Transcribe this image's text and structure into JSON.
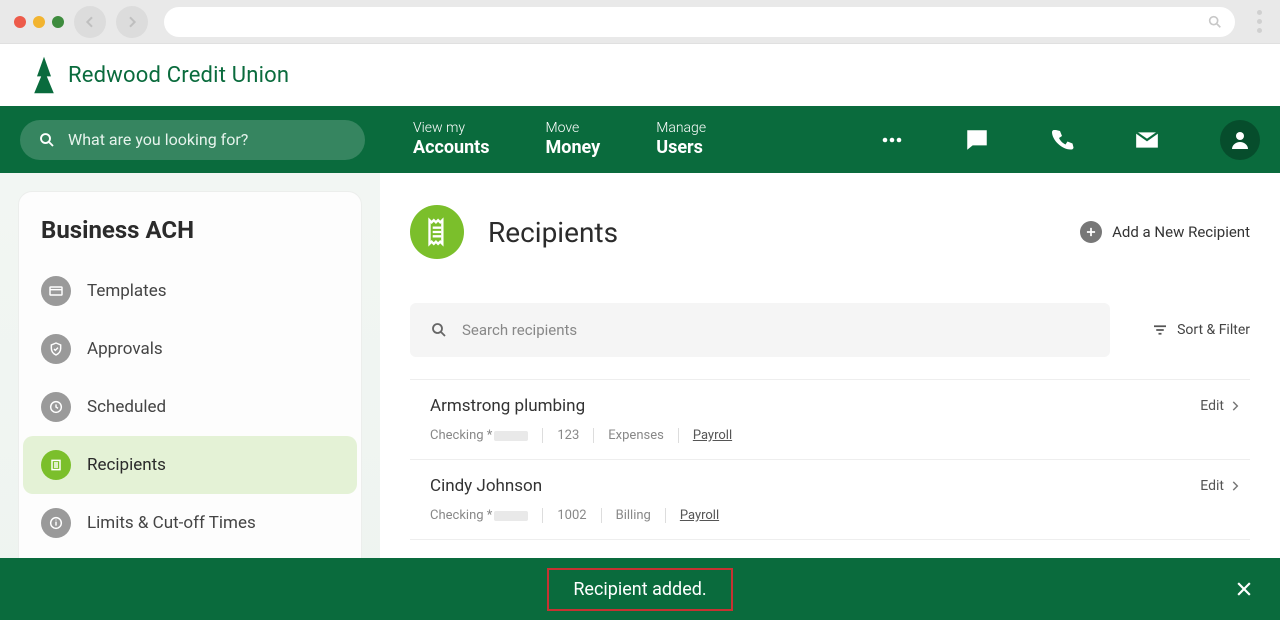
{
  "brand": "Redwood Credit Union",
  "global_search_placeholder": "What are you looking for?",
  "nav": [
    {
      "top": "View my",
      "bottom": "Accounts"
    },
    {
      "top": "Move",
      "bottom": "Money"
    },
    {
      "top": "Manage",
      "bottom": "Users"
    }
  ],
  "sidebar": {
    "title": "Business ACH",
    "items": [
      {
        "label": "Templates",
        "icon": "templates"
      },
      {
        "label": "Approvals",
        "icon": "approvals"
      },
      {
        "label": "Scheduled",
        "icon": "scheduled"
      },
      {
        "label": "Recipients",
        "icon": "recipients",
        "active": true
      },
      {
        "label": "Limits & Cut-off Times",
        "icon": "limits"
      }
    ]
  },
  "page": {
    "title": "Recipients",
    "add_label": "Add a New Recipient",
    "search_placeholder": "Search recipients",
    "sort_label": "Sort & Filter",
    "edit_label": "Edit",
    "rows": [
      {
        "name": "Armstrong plumbing",
        "account_label": "Checking *",
        "id": "123",
        "category": "Expenses",
        "tag": "Payroll"
      },
      {
        "name": "Cindy Johnson",
        "account_label": "Checking *",
        "id": "1002",
        "category": "Billing",
        "tag": "Payroll"
      }
    ]
  },
  "toast": {
    "message": "Recipient added."
  }
}
